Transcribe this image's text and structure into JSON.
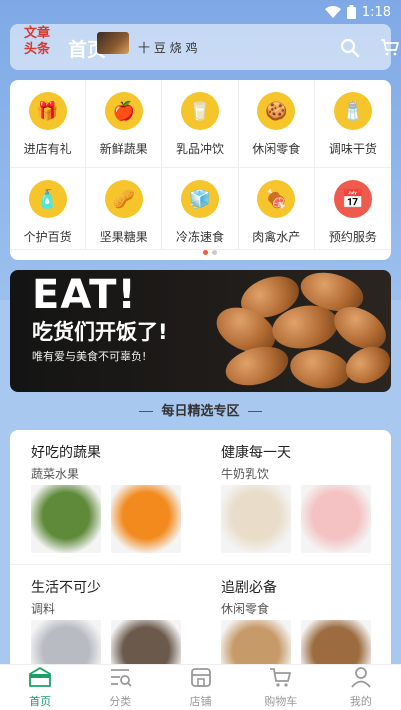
{
  "status_bar": {
    "time": "1:18"
  },
  "header": {
    "logo_text": "文章\n头条",
    "title": "首页",
    "subtitle": "十 豆 烧 鸡"
  },
  "categories": [
    {
      "label": "进店有礼",
      "icon": "gift-icon",
      "glyph": "🎁",
      "color": "#f6c52b"
    },
    {
      "label": "新鲜蔬果",
      "icon": "fruits-icon",
      "glyph": "🍎",
      "color": "#f6c52b"
    },
    {
      "label": "乳品冲饮",
      "icon": "milk-icon",
      "glyph": "🥛",
      "color": "#f6c52b"
    },
    {
      "label": "休闲零食",
      "icon": "snacks-icon",
      "glyph": "🍪",
      "color": "#f6c52b"
    },
    {
      "label": "调味干货",
      "icon": "seasoning-icon",
      "glyph": "🧂",
      "color": "#f6c52b"
    },
    {
      "label": "个护百货",
      "icon": "personal-care-icon",
      "glyph": "🧴",
      "color": "#f6c52b"
    },
    {
      "label": "坚果糖果",
      "icon": "nuts-icon",
      "glyph": "🥜",
      "color": "#f6c52b"
    },
    {
      "label": "冷冻速食",
      "icon": "frozen-food-icon",
      "glyph": "🧊",
      "color": "#f6c52b"
    },
    {
      "label": "肉禽水产",
      "icon": "meat-icon",
      "glyph": "🍖",
      "color": "#f6c52b"
    },
    {
      "label": "预约服务",
      "icon": "calendar-icon",
      "glyph": "📅",
      "color": "#ee5a4e"
    }
  ],
  "banner": {
    "headline": "EAT!",
    "main_text": "吃货们开饭了!",
    "sub_text": "唯有爱与美食不可辜负!"
  },
  "section": {
    "title": "每日精选专区"
  },
  "featured": [
    {
      "title": "好吃的蔬果",
      "subtitle": "蔬菜水果",
      "img_colors": [
        "#5f8a3a",
        "#f28a1e"
      ]
    },
    {
      "title": "健康每一天",
      "subtitle": "牛奶乳饮",
      "img_colors": [
        "#e9dcc8",
        "#f4c2c2"
      ]
    },
    {
      "title": "生活不可少",
      "subtitle": "调料",
      "img_colors": [
        "#b8bcc2",
        "#6b5a4c"
      ]
    },
    {
      "title": "追剧必备",
      "subtitle": "休闲零食",
      "img_colors": [
        "#c79a6a",
        "#9c6b3f"
      ]
    }
  ],
  "bottom_nav": [
    {
      "label": "首页",
      "icon": "home-icon",
      "active": true
    },
    {
      "label": "分类",
      "icon": "category-icon",
      "active": false
    },
    {
      "label": "店铺",
      "icon": "store-icon",
      "active": false
    },
    {
      "label": "购物车",
      "icon": "cart-icon",
      "active": false
    },
    {
      "label": "我的",
      "icon": "profile-icon",
      "active": false
    }
  ],
  "colors": {
    "accent": "#1aa06a",
    "background": "#8fb4e8",
    "dot_active": "#f25a3a"
  }
}
